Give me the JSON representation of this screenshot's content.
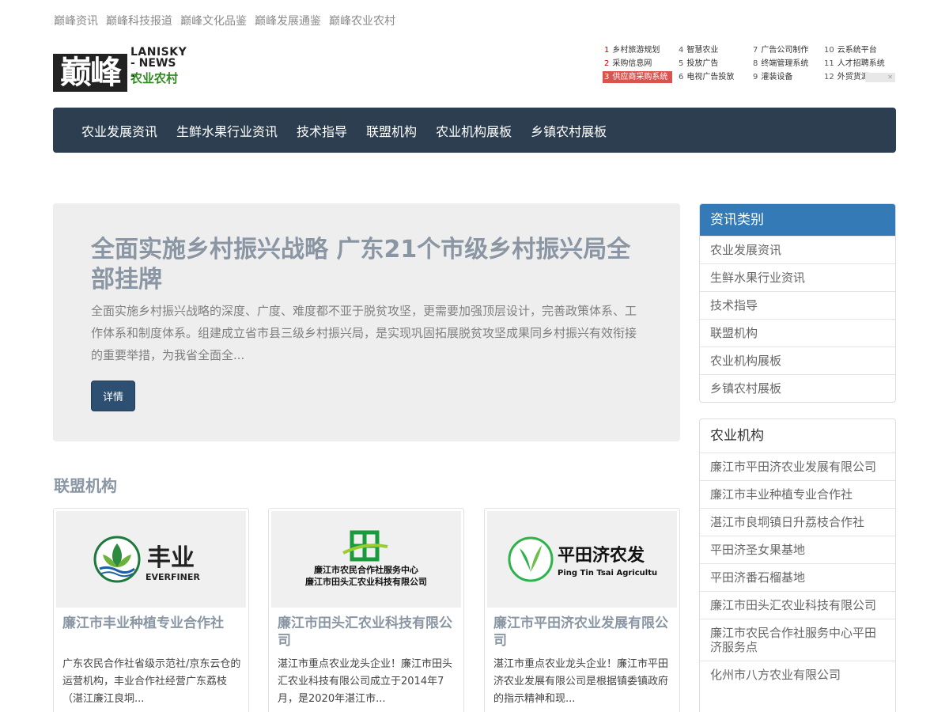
{
  "toplinks": [
    "巅峰资讯",
    "巅峰科技报道",
    "巅峰文化品鉴",
    "巅峰发展通鉴",
    "巅峰农业农村"
  ],
  "logo": {
    "mark": "巅峰",
    "en1": "LANISKY",
    "en2": "- NEWS -",
    "cn": "农业农村"
  },
  "hotlist": [
    {
      "num": "1",
      "label": "乡村旅游规划"
    },
    {
      "num": "4",
      "label": "智慧农业"
    },
    {
      "num": "7",
      "label": "广告公司制作"
    },
    {
      "num": "10",
      "label": "云系统平台"
    },
    {
      "num": "2",
      "label": "采购信息网"
    },
    {
      "num": "5",
      "label": "投放广告"
    },
    {
      "num": "8",
      "label": "终端管理系统"
    },
    {
      "num": "11",
      "label": "人才招聘系统"
    },
    {
      "num": "3",
      "label": "供应商采购系统"
    },
    {
      "num": "6",
      "label": "电视广告投放"
    },
    {
      "num": "9",
      "label": "灌装设备"
    },
    {
      "num": "12",
      "label": "外贸货源"
    }
  ],
  "nav": [
    "农业发展资讯",
    "生鲜水果行业资讯",
    "技术指导",
    "联盟机构",
    "农业机构展板",
    "乡镇农村展板"
  ],
  "hero": {
    "title": "全面实施乡村振兴战略 广东21个市级乡村振兴局全部挂牌",
    "summary": "全面实施乡村振兴战略的深度、广度、难度都不亚于脱贫攻坚，更需要加强顶层设计，完善政策体系、工作体系和制度体系。组建成立省市县三级乡村振兴局，是实现巩固拓展脱贫攻坚成果同乡村振兴有效衔接的重要举措，为我省全面全...",
    "button": "详情"
  },
  "section_title": "联盟机构",
  "cards": [
    {
      "logo_cn": "丰业",
      "logo_en": "EVERFINER",
      "title": "廉江市丰业种植专业合作社",
      "desc": "广东农民合作社省级示范社/京东云仓的运营机构，丰业合作社经营广东荔枝（湛江廉江良垌..."
    },
    {
      "logo_line1": "廉江市农民合作社服务中心",
      "logo_line2": "廉江市田头汇农业科技有限公司",
      "title": "廉江市田头汇农业科技有限公司",
      "desc": "湛江市重点农业龙头企业！廉江市田头汇农业科技有限公司成立于2014年7月，是2020年湛江市..."
    },
    {
      "logo_cn": "平田济农发",
      "logo_en": "Ping Tin Tsai Agriculture",
      "title": "廉江市平田济农业发展有限公司",
      "desc": "湛江市重点农业龙头企业！廉江市平田济农业发展有限公司是根据镇委镇政府的指示精神和现..."
    }
  ],
  "sidebar": {
    "categories_title": "资讯类别",
    "categories": [
      "农业发展资讯",
      "生鲜水果行业资讯",
      "技术指导",
      "联盟机构",
      "农业机构展板",
      "乡镇农村展板"
    ],
    "orgs_title": "农业机构",
    "orgs": [
      "廉江市平田济农业发展有限公司",
      "廉江市丰业种植专业合作社",
      "湛江市良垌镇日升荔枝合作社",
      "平田济圣女果基地",
      "平田济番石榴基地",
      "廉江市田头汇农业科技有限公司",
      "廉江市农民合作社服务中心平田济服务点",
      "化州市八方农业有限公司"
    ]
  }
}
